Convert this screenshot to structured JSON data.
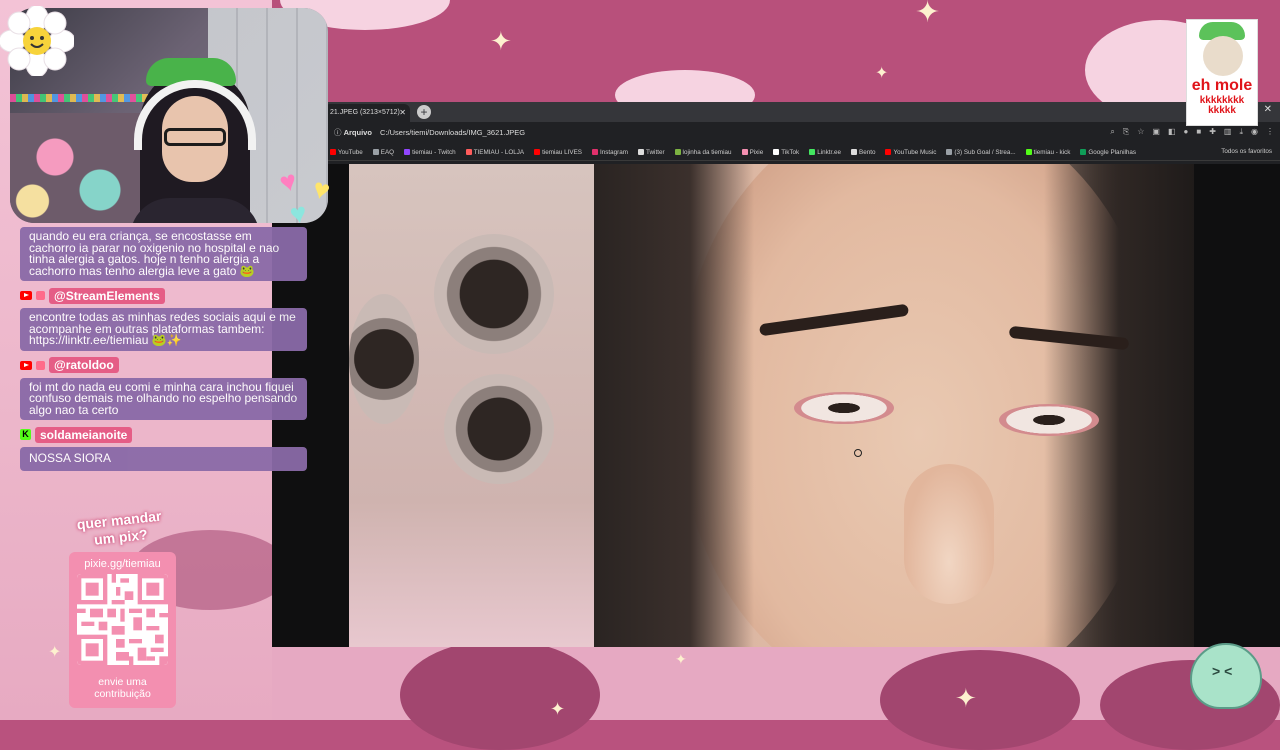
{
  "stream": {
    "chat": [
      {
        "platform": "youtube",
        "user": "",
        "text": "quando eu era criança, se encostasse em cachorro ia parar no oxigenio no hospital e nao tinha alergia a gatos. hoje n tenho alergia a cachorro mas tenho alergia leve a gato 🐸"
      },
      {
        "platform": "youtube",
        "user": "@StreamElements",
        "text": "encontre todas as minhas redes sociais aqui e me acompanhe em outras plataformas tambem: https://linktr.ee/tiemiau 🐸✨"
      },
      {
        "platform": "youtube",
        "user": "@ratoldoo",
        "text": "foi mt do nada eu comi e minha cara inchou fiquei confuso demais me olhando no espelho pensando algo nao ta certo"
      },
      {
        "platform": "kick",
        "user": "soldameianoite",
        "text": "NOSSA SIORA"
      }
    ],
    "pix": {
      "title_line1": "quer mandar",
      "title_line2": "um pix?",
      "url": "pixie.gg/tiemiau",
      "footer_line1": "envie uma",
      "footer_line2": "contribuição"
    },
    "meme": {
      "line1": "eh mole",
      "line2": "kkkkkkkk",
      "line3": "kkkkk"
    }
  },
  "browser": {
    "tab_title": "21.JPEG (3213×5712)",
    "omnibox_label": "Arquivo",
    "omnibox_url": "C:/Users/tiemi/Downloads/IMG_3621.JPEG",
    "bookmarks": [
      {
        "label": "YouTube",
        "color": "#ff0000"
      },
      {
        "label": "EAQ",
        "color": "#9aa0a6"
      },
      {
        "label": "tiemiau - Twitch",
        "color": "#9146ff"
      },
      {
        "label": "TIEMIAU - LOLJA",
        "color": "#ff5c5c"
      },
      {
        "label": "tiemiau LIVES",
        "color": "#ff0000"
      },
      {
        "label": "Instagram",
        "color": "#e1306c"
      },
      {
        "label": "Twitter",
        "color": "#dddddd"
      },
      {
        "label": "lojinha da tiemiau",
        "color": "#7cb342"
      },
      {
        "label": "Pixie",
        "color": "#f48fb1"
      },
      {
        "label": "TikTok",
        "color": "#ffffff"
      },
      {
        "label": "Linktr.ee",
        "color": "#43e660"
      },
      {
        "label": "Bento",
        "color": "#dddddd"
      },
      {
        "label": "YouTube Music",
        "color": "#ff0000"
      },
      {
        "label": "(3) Sub Goal / Strea...",
        "color": "#9aa0a6"
      },
      {
        "label": "tiemiau - kick",
        "color": "#53fc18"
      },
      {
        "label": "Google Planilhas",
        "color": "#0f9d58"
      }
    ],
    "all_bookmarks": "Todos os favoritos"
  }
}
